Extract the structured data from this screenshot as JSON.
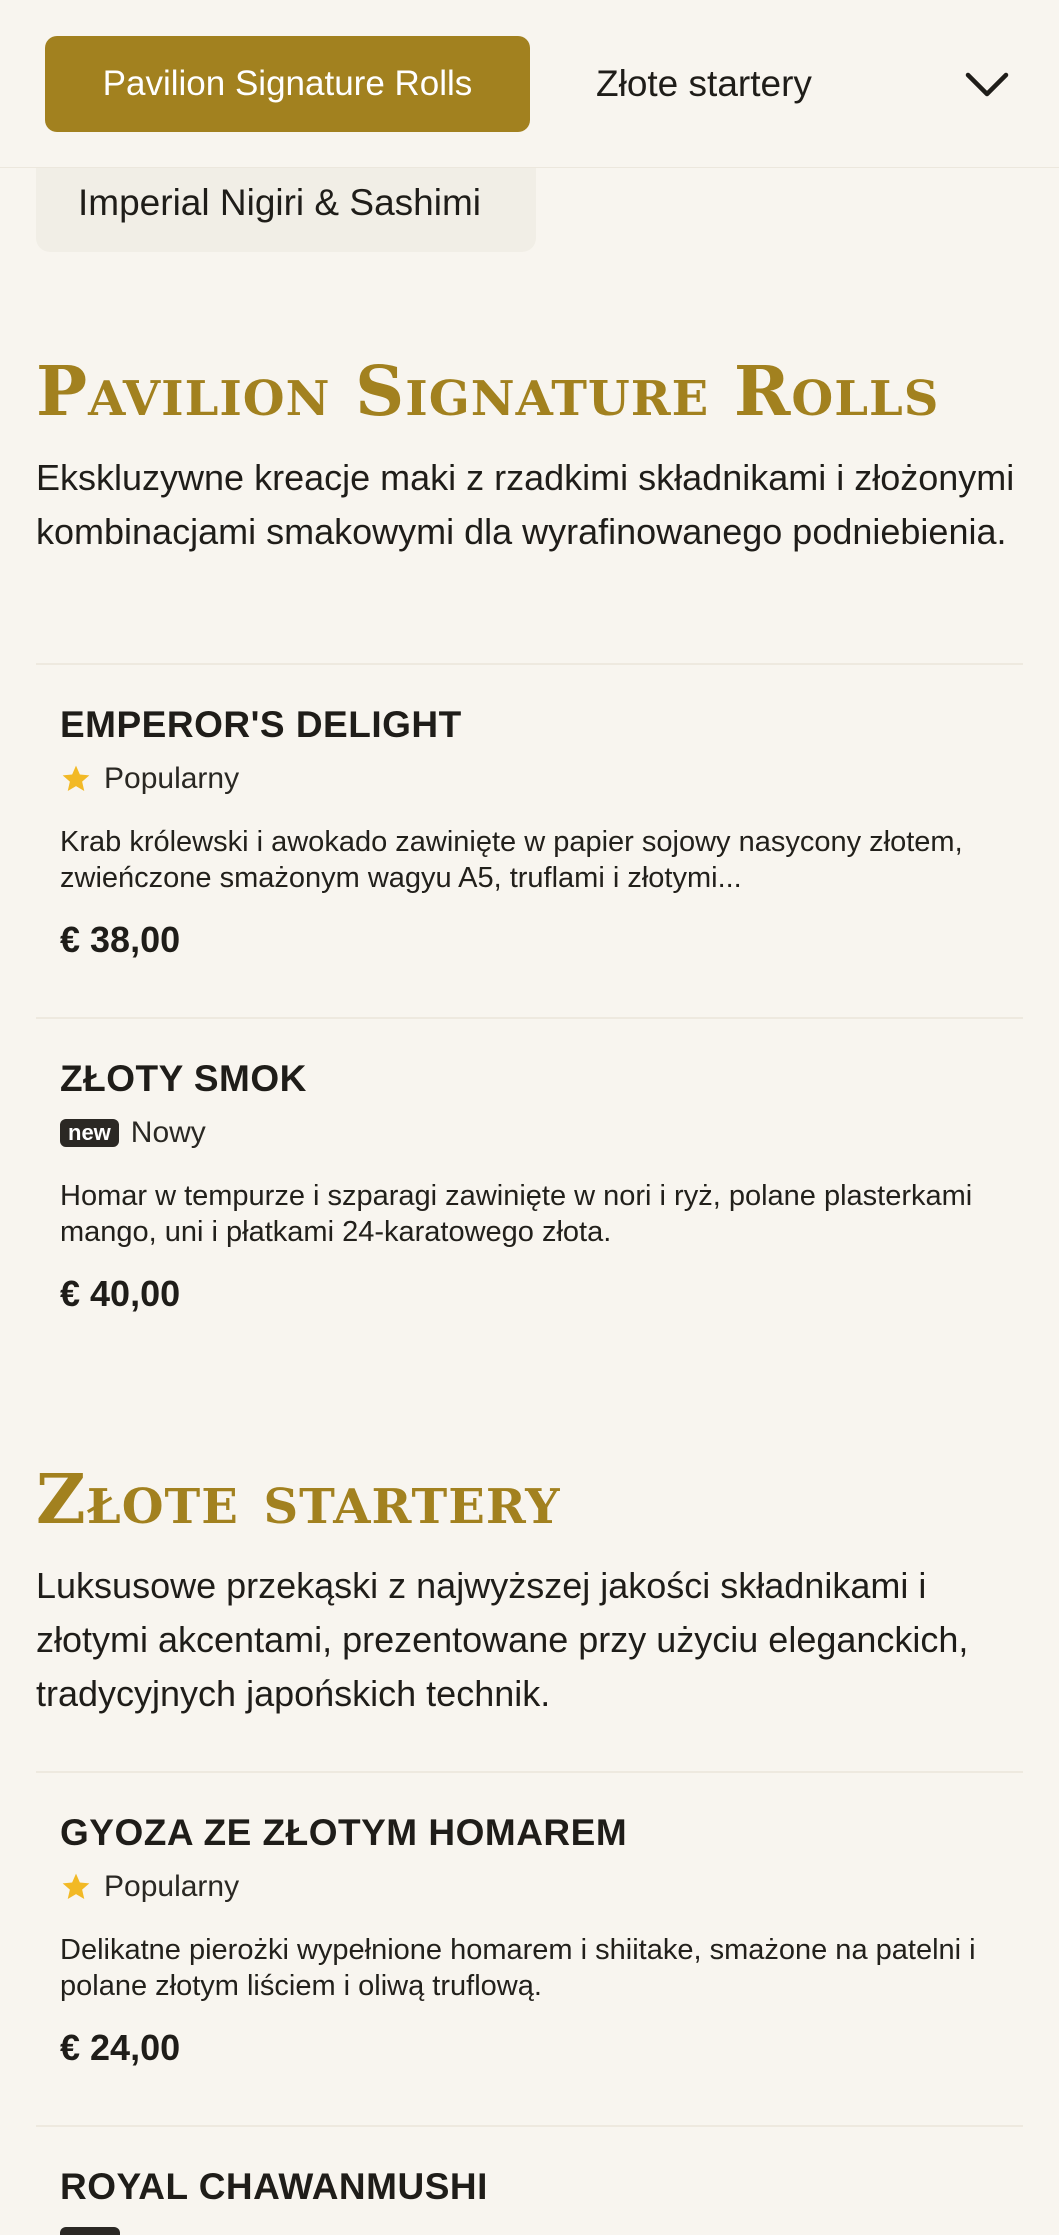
{
  "category_bar": {
    "active_tab": "Pavilion Signature Rolls",
    "tab_2": "Złote startery",
    "tab_3": "Imperial Nigiri & Sashimi",
    "expand_icon": "chevron-down-icon"
  },
  "sections": [
    {
      "title": "Pavilion Signature Rolls",
      "description": "Ekskluzywne kreacje maki z rzadkimi składnikami i złożonymi kombinacjami smakowymi dla wyrafinowanego podniebienia.",
      "items": [
        {
          "name": "EMPEROR'S DELIGHT",
          "badge_icon": "star-icon",
          "badge_label": "Popularny",
          "description": "Krab królewski i awokado zawinięte w papier sojowy nasycony złotem, zwieńczone smażonym wagyu A5, truflami i złotymi...",
          "price": "€ 38,00"
        },
        {
          "name": "ZŁOTY SMOK",
          "badge_tag": "new",
          "badge_label": "Nowy",
          "description": "Homar w tempurze i szparagi zawinięte w nori i ryż, polane plasterkami mango, uni i płatkami 24-karatowego złota.",
          "price": "€ 40,00"
        }
      ]
    },
    {
      "title": "Złote startery",
      "description": "Luksusowe przekąski z najwyższej jakości składnikami i złotymi akcentami, prezentowane przy użyciu eleganckich, tradycyjnych japońskich technik.",
      "items": [
        {
          "name": "GYOZA ZE ZŁOTYM HOMAREM",
          "badge_icon": "star-icon",
          "badge_label": "Popularny",
          "description": "Delikatne pierożki wypełnione homarem i shiitake, smażone na patelni i polane złotym liściem i oliwą truflową.",
          "price": "€ 24,00"
        },
        {
          "name": "ROYAL CHAWANMUSHI"
        }
      ]
    }
  ],
  "colors": {
    "gold": "#a2811f",
    "background": "#f8f5ef",
    "star": "#f2b925",
    "text": "#1f1d19"
  }
}
